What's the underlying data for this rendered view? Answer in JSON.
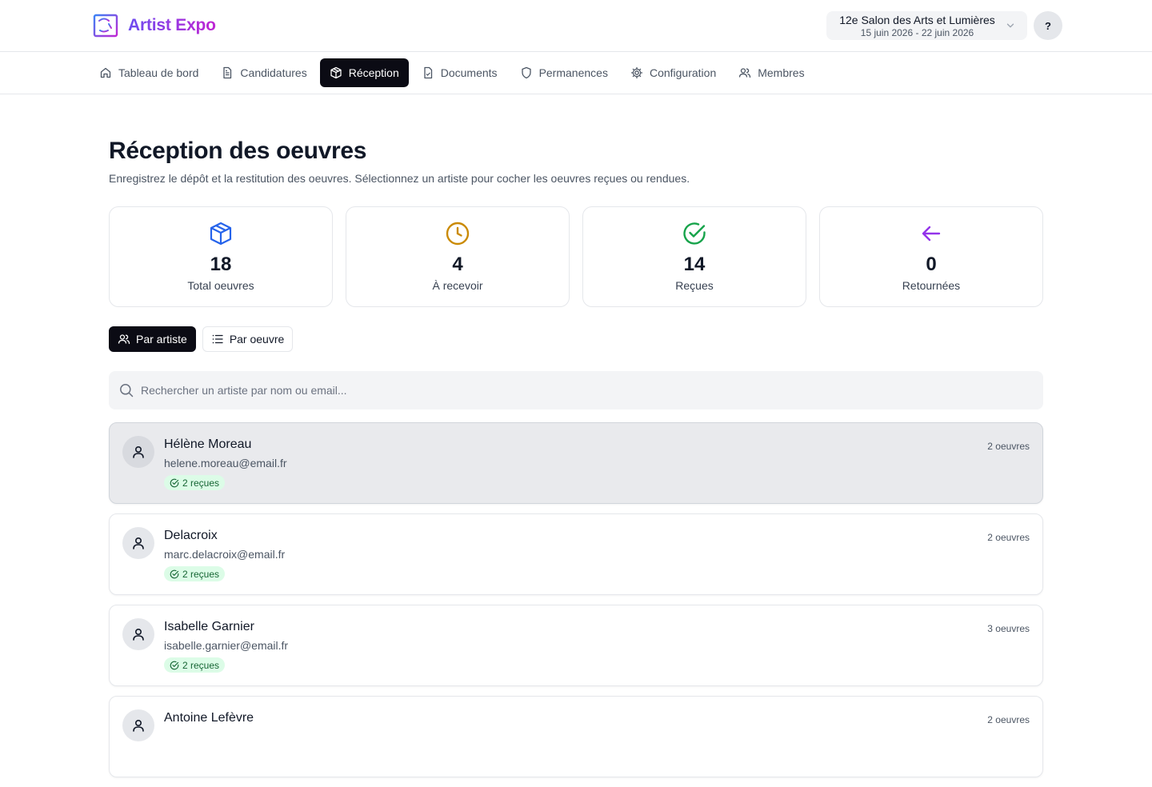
{
  "app": {
    "name": "Artist Expo"
  },
  "event": {
    "name": "12e Salon des Arts et Lumières",
    "dates": "15 juin 2026 - 22 juin 2026"
  },
  "help": {
    "label": "?"
  },
  "nav": [
    {
      "label": "Tableau de bord",
      "icon": "home-icon"
    },
    {
      "label": "Candidatures",
      "icon": "file-text-icon"
    },
    {
      "label": "Réception",
      "icon": "package-icon",
      "active": true
    },
    {
      "label": "Documents",
      "icon": "file-check-icon"
    },
    {
      "label": "Permanences",
      "icon": "shield-icon"
    },
    {
      "label": "Configuration",
      "icon": "gear-icon"
    },
    {
      "label": "Membres",
      "icon": "users-icon"
    }
  ],
  "page": {
    "title": "Réception des oeuvres",
    "description": "Enregistrez le dépôt et la restitution des oeuvres. Sélectionnez un artiste pour cocher les oeuvres reçues ou rendues."
  },
  "stats": [
    {
      "value": "18",
      "label": "Total oeuvres",
      "icon": "package-icon",
      "color": "#2563eb"
    },
    {
      "value": "4",
      "label": "À recevoir",
      "icon": "clock-icon",
      "color": "#ca8a04"
    },
    {
      "value": "14",
      "label": "Reçues",
      "icon": "check-circle-icon",
      "color": "#16a34a"
    },
    {
      "value": "0",
      "label": "Retournées",
      "icon": "arrow-left-icon",
      "color": "#9333ea"
    }
  ],
  "view_toggle": {
    "by_artist": "Par artiste",
    "by_work": "Par oeuvre"
  },
  "search": {
    "placeholder": "Rechercher un artiste par nom ou email..."
  },
  "artists": [
    {
      "name": "Hélène Moreau",
      "email": "helene.moreau@email.fr",
      "received": "2 reçues",
      "count": "2 oeuvres",
      "selected": true
    },
    {
      "name": "Delacroix",
      "email": "marc.delacroix@email.fr",
      "received": "2 reçues",
      "count": "2 oeuvres"
    },
    {
      "name": "Isabelle Garnier",
      "email": "isabelle.garnier@email.fr",
      "received": "2 reçues",
      "count": "3 oeuvres"
    },
    {
      "name": "Antoine Lefèvre",
      "email": "",
      "received": "",
      "count": "2 oeuvres"
    }
  ],
  "colors": {
    "accent": "#0b0b14",
    "brand_start": "#6d4cf0",
    "brand_end": "#c026d3",
    "success_bg": "#dcfce7",
    "success_text": "#166534"
  }
}
